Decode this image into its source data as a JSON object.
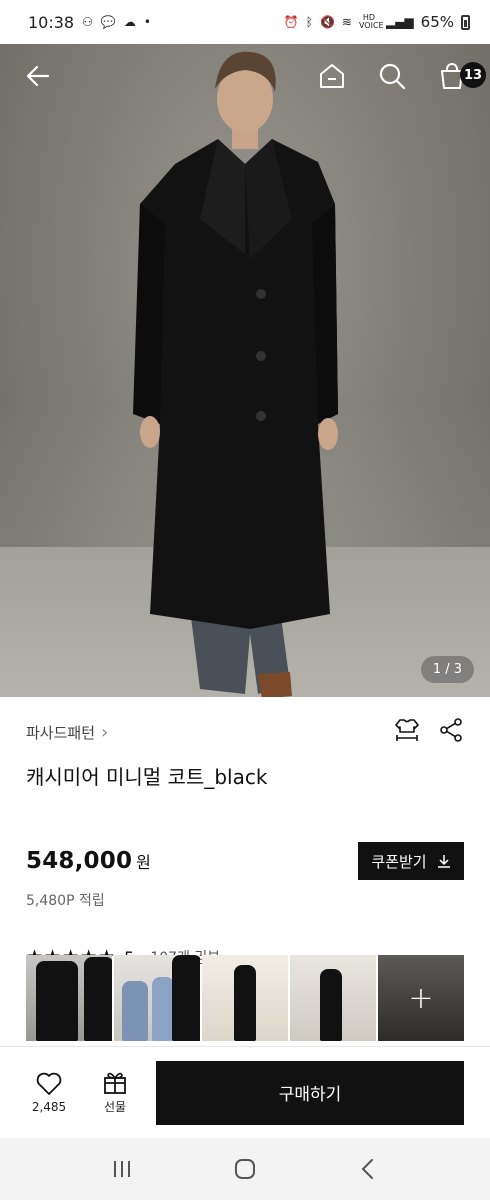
{
  "status_bar": {
    "time": "10:38",
    "battery": "65%",
    "network_label": "HD VOICE"
  },
  "hero": {
    "page_indicator": "1 / 3",
    "cart_count": "13"
  },
  "product": {
    "brand": "파사드패턴",
    "brand_chevron": "›",
    "title": "캐시미어 미니멀 코트_black",
    "price": "548,000",
    "price_unit": "원",
    "points": "5,480P 적립",
    "coupon_label": "쿠폰받기",
    "stars": "★★★★★",
    "rating": "5",
    "review_count": "107개 리뷰"
  },
  "thumbnails": [
    {
      "icon": "thumbnail-image"
    },
    {
      "icon": "thumbnail-image"
    },
    {
      "icon": "thumbnail-image"
    },
    {
      "icon": "thumbnail-image"
    },
    {
      "icon": "thumbnail-more",
      "label": "+"
    }
  ],
  "action_bar": {
    "like_count": "2,485",
    "gift_label": "선물",
    "buy_label": "구매하기"
  },
  "colors": {
    "primary": "#111111",
    "background": "#ffffff"
  }
}
